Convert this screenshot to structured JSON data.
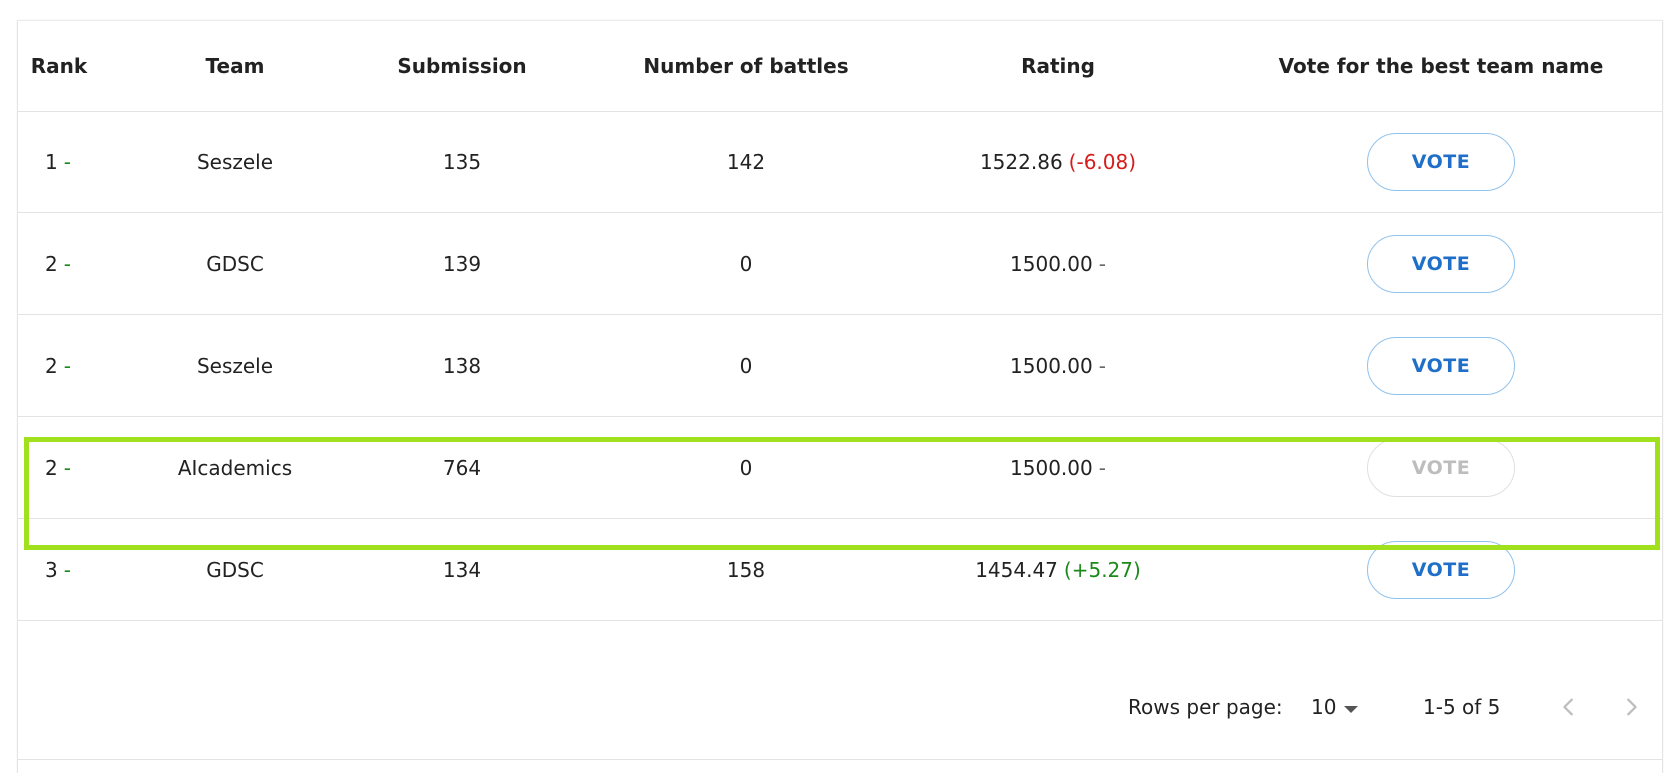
{
  "table": {
    "columns": [
      "Rank",
      "Team",
      "Submission",
      "Number of battles",
      "Rating",
      "Vote for the best team name"
    ],
    "rows": [
      {
        "rank": "1",
        "rank_dash": "-",
        "team": "Seszele",
        "submission": "135",
        "battles": "142",
        "rating": "1522.86",
        "delta": "(-6.08)",
        "vote": "VOTE"
      },
      {
        "rank": "2",
        "rank_dash": "-",
        "team": "GDSC",
        "submission": "139",
        "battles": "0",
        "rating": "1500.00",
        "delta": "-",
        "vote": "VOTE"
      },
      {
        "rank": "2",
        "rank_dash": "-",
        "team": "Seszele",
        "submission": "138",
        "battles": "0",
        "rating": "1500.00",
        "delta": "-",
        "vote": "VOTE"
      },
      {
        "rank": "2",
        "rank_dash": "-",
        "team": "AIcademics",
        "submission": "764",
        "battles": "0",
        "rating": "1500.00",
        "delta": "-",
        "vote": "VOTE"
      },
      {
        "rank": "3",
        "rank_dash": "-",
        "team": "GDSC",
        "submission": "134",
        "battles": "158",
        "rating": "1454.47",
        "delta": "(+5.27)",
        "vote": "VOTE"
      }
    ]
  },
  "pagination": {
    "rows_per_page_label": "Rows per page:",
    "rows_per_page_value": "10",
    "range_text": "1-5 of 5"
  },
  "icons": {
    "rows_per_page_caret": "caret-down-icon",
    "prev": "chevron-left-icon",
    "next": "chevron-right-icon"
  },
  "colors": {
    "negative_delta": "#d81b1b",
    "positive_delta": "#1b8a1b",
    "vote_button_text": "#1f6fc9",
    "highlight_outline": "#a0e01c"
  }
}
